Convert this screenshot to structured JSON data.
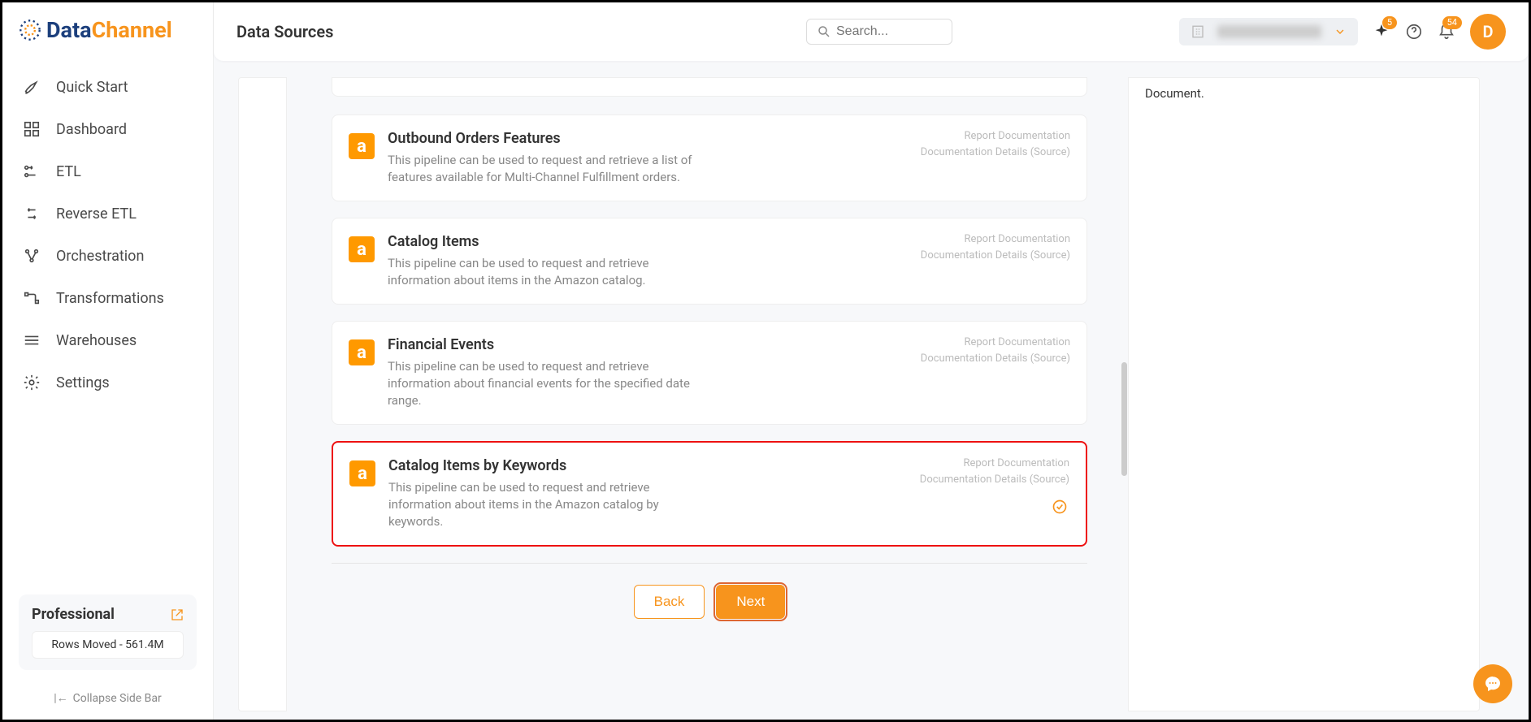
{
  "header": {
    "title": "Data Sources",
    "search_placeholder": "Search...",
    "sparkle_badge": "5",
    "bell_badge": "54",
    "avatar_letter": "D"
  },
  "logo": {
    "data": "Data",
    "channel": "Channel"
  },
  "sidebar": {
    "items": [
      {
        "label": "Quick Start"
      },
      {
        "label": "Dashboard"
      },
      {
        "label": "ETL"
      },
      {
        "label": "Reverse ETL"
      },
      {
        "label": "Orchestration"
      },
      {
        "label": "Transformations"
      },
      {
        "label": "Warehouses"
      },
      {
        "label": "Settings"
      }
    ],
    "plan": {
      "title": "Professional",
      "rows": "Rows Moved - 561.4M"
    },
    "collapse": "Collapse Side Bar"
  },
  "pipelines": [
    {
      "title": "Outbound Orders Features",
      "desc": "This pipeline can be used to request and retrieve a list of features available for Multi-Channel Fulfillment orders.",
      "link1": "Report Documentation",
      "link2": "Documentation Details (Source)"
    },
    {
      "title": "Catalog Items",
      "desc": "This pipeline can be used to request and retrieve information about items in the Amazon catalog.",
      "link1": "Report Documentation",
      "link2": "Documentation Details (Source)"
    },
    {
      "title": "Financial Events",
      "desc": "This pipeline can be used to request and retrieve information about financial events for the specified date range.",
      "link1": "Report Documentation",
      "link2": "Documentation Details (Source)"
    },
    {
      "title": "Catalog Items by Keywords",
      "desc": "This pipeline can be used to request and retrieve information about items in the Amazon catalog by keywords.",
      "link1": "Report Documentation",
      "link2": "Documentation Details (Source)"
    }
  ],
  "buttons": {
    "back": "Back",
    "next": "Next"
  },
  "right_panel": {
    "text": "Document."
  }
}
